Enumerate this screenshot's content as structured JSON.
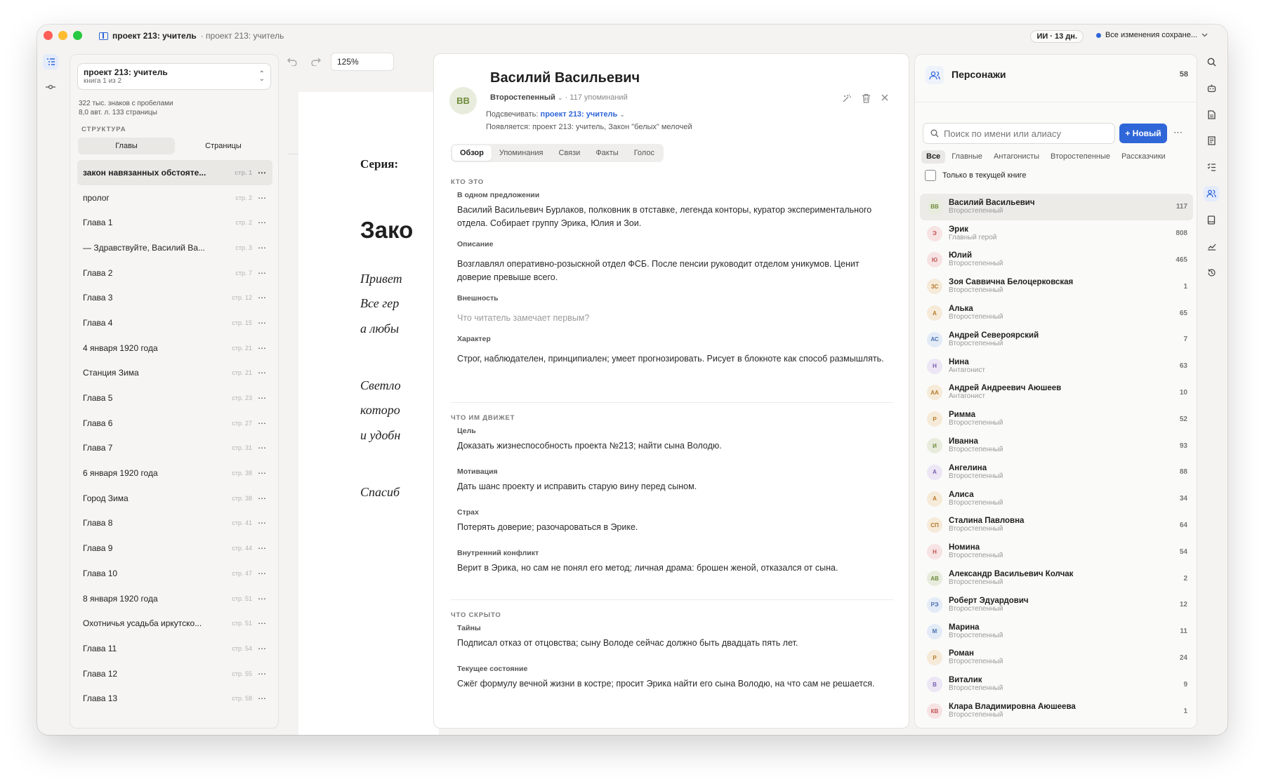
{
  "titlebar": {
    "title_bold": "проект 213: учитель",
    "title_sub": "· проект 213: учитель",
    "ai_pill": "ИИ · 13 дн.",
    "save_status": "Все изменения сохране..."
  },
  "project": {
    "name": "проект 213: учитель",
    "book_info": "книга 1 из 2",
    "stats_line1": "322 тыс. знаков с пробелами",
    "stats_line2": "8,0 авт. л.  133 страницы",
    "structure_label": "СТРУКТУРА",
    "seg_chapters": "Главы",
    "seg_pages": "Страницы"
  },
  "chapters": [
    {
      "name": "закон навязанных обстояте...",
      "page": "стр. 1",
      "active": true
    },
    {
      "name": "пролог",
      "page": "стр. 2"
    },
    {
      "name": "Глава 1",
      "page": "стр. 2"
    },
    {
      "name": "— Здравствуйте, Василий Ва...",
      "page": "стр. 3"
    },
    {
      "name": "Глава 2",
      "page": "стр. 7"
    },
    {
      "name": "Глава 3",
      "page": "стр. 12"
    },
    {
      "name": "Глава 4",
      "page": "стр. 15"
    },
    {
      "name": "4 января 1920 года",
      "page": "стр. 21"
    },
    {
      "name": "Станция Зима",
      "page": "стр. 21"
    },
    {
      "name": "Глава 5",
      "page": "стр. 23"
    },
    {
      "name": "Глава 6",
      "page": "стр. 27"
    },
    {
      "name": "Глава 7",
      "page": "стр. 31"
    },
    {
      "name": "6 января 1920 года",
      "page": "стр. 38"
    },
    {
      "name": "Город Зима",
      "page": "стр. 38"
    },
    {
      "name": "Глава 8",
      "page": "стр. 41"
    },
    {
      "name": "Глава 9",
      "page": "стр. 44"
    },
    {
      "name": "Глава 10",
      "page": "стр. 47"
    },
    {
      "name": "8 января 1920 года",
      "page": "стр. 51"
    },
    {
      "name": "Охотничья усадьба иркутско...",
      "page": "стр. 51"
    },
    {
      "name": "Глава 11",
      "page": "стр. 54"
    },
    {
      "name": "Глава 12",
      "page": "стр. 55"
    },
    {
      "name": "Глава 13",
      "page": "стр. 58"
    }
  ],
  "editor": {
    "zoom": "125%",
    "series": "Серия:",
    "heading": "Зако",
    "lines": [
      "Привет",
      "Все гер",
      "а любы",
      "Светло",
      "которо",
      "и удобн",
      "Спасиб"
    ]
  },
  "character": {
    "initials": "ВВ",
    "name": "Василий Васильевич",
    "role": "Второстепенный",
    "mentions": "· 117 упоминаний",
    "highlight_label": "Подсвечивать:",
    "highlight_value": "проект 213: учитель",
    "appears": "Появляется: проект 213: учитель, Закон \"белых\" мелочей",
    "tabs": [
      "Обзор",
      "Упоминания",
      "Связи",
      "Факты",
      "Голос"
    ],
    "sec_who": "КТО ЭТО",
    "sec_drive": "ЧТО ИМ ДВИЖЕТ",
    "sec_hidden": "ЧТО СКРЫТО",
    "one_sentence_label": "В одном предложении",
    "one_sentence": "Василий Васильевич Бурлаков, полковник в отставке, легенда конторы, куратор экспериментального отдела. Собирает группу Эрика, Юлия и Зои.",
    "description_label": "Описание",
    "description": "Возглавлял оперативно-розыскной отдел ФСБ. После пенсии руководит отделом уникумов. Ценит доверие превыше всего.",
    "appearance_label": "Внешность",
    "appearance_placeholder": "Что читатель замечает первым?",
    "character_label": "Характер",
    "character_text": "Строг, наблюдателен, принципиален; умеет прогнозировать. Рисует в блокноте как способ размышлять.",
    "goal_label": "Цель",
    "goal": "Доказать жизнеспособность проекта №213; найти сына Володю.",
    "motivation_label": "Мотивация",
    "motivation": "Дать шанс проекту и исправить старую вину перед сыном.",
    "fear_label": "Страх",
    "fear": "Потерять доверие; разочароваться в Эрике.",
    "conflict_label": "Внутренний конфликт",
    "conflict": "Верит в Эрика, но сам не понял его метод; личная драма: брошен женой, отказался от сына.",
    "secrets_label": "Тайны",
    "secrets": "Подписал отказ от отцовства; сыну Володе сейчас должно быть двадцать пять лет.",
    "state_label": "Текущее состояние",
    "state": "Сжёг формулу вечной жизни в костре; просит Эрика найти его сына Володю, на что сам не решается."
  },
  "characters_panel": {
    "title": "Персонажи",
    "count": "58",
    "search_placeholder": "Поиск по имени или алиасу",
    "new_button": "+ Новый",
    "filters": [
      "Все",
      "Главные",
      "Антагонисты",
      "Второстепенные",
      "Рассказчики"
    ],
    "only_current": "Только в текущей книге",
    "list": [
      {
        "initials": "ВВ",
        "name": "Василий Васильевич",
        "role": "Второстепенный",
        "count": "117",
        "bg": "#e8ecdd",
        "fg": "#6e8a3a",
        "active": true
      },
      {
        "initials": "Э",
        "name": "Эрик",
        "role": "Главный герой",
        "count": "808",
        "bg": "#f7e3e3",
        "fg": "#c25555"
      },
      {
        "initials": "Ю",
        "name": "Юлий",
        "role": "Второстепенный",
        "count": "465",
        "bg": "#f7e3e3",
        "fg": "#c25555"
      },
      {
        "initials": "ЗС",
        "name": "Зоя Саввична Белоцерковская",
        "role": "Второстепенный",
        "count": "1",
        "bg": "#f6ead8",
        "fg": "#b57a2c"
      },
      {
        "initials": "А",
        "name": "Алька",
        "role": "Второстепенный",
        "count": "65",
        "bg": "#f6ead8",
        "fg": "#b57a2c"
      },
      {
        "initials": "АС",
        "name": "Андрей Североярский",
        "role": "Второстепенный",
        "count": "7",
        "bg": "#e3ebf7",
        "fg": "#4a72b0"
      },
      {
        "initials": "Н",
        "name": "Нина",
        "role": "Антагонист",
        "count": "63",
        "bg": "#ece6f5",
        "fg": "#7a5fae"
      },
      {
        "initials": "АА",
        "name": "Андрей Андреевич Аюшеев",
        "role": "Антагонист",
        "count": "10",
        "bg": "#f6ead8",
        "fg": "#b57a2c"
      },
      {
        "initials": "Р",
        "name": "Римма",
        "role": "Второстепенный",
        "count": "52",
        "bg": "#f6ead8",
        "fg": "#b57a2c"
      },
      {
        "initials": "И",
        "name": "Иванна",
        "role": "Второстепенный",
        "count": "93",
        "bg": "#e8ecdd",
        "fg": "#6e8a3a"
      },
      {
        "initials": "А",
        "name": "Ангелина",
        "role": "Второстепенный",
        "count": "88",
        "bg": "#ece6f5",
        "fg": "#7a5fae"
      },
      {
        "initials": "А",
        "name": "Алиса",
        "role": "Второстепенный",
        "count": "34",
        "bg": "#f6ead8",
        "fg": "#b57a2c"
      },
      {
        "initials": "СП",
        "name": "Сталина Павловна",
        "role": "Второстепенный",
        "count": "64",
        "bg": "#f6ead8",
        "fg": "#b57a2c"
      },
      {
        "initials": "Н",
        "name": "Номина",
        "role": "Второстепенный",
        "count": "54",
        "bg": "#f7e3e3",
        "fg": "#c25555"
      },
      {
        "initials": "АВ",
        "name": "Александр Васильевич Колчак",
        "role": "Второстепенный",
        "count": "2",
        "bg": "#e8ecdd",
        "fg": "#6e8a3a"
      },
      {
        "initials": "РЭ",
        "name": "Роберт Эдуардович",
        "role": "Второстепенный",
        "count": "12",
        "bg": "#e3ebf7",
        "fg": "#4a72b0"
      },
      {
        "initials": "М",
        "name": "Марина",
        "role": "Второстепенный",
        "count": "11",
        "bg": "#e3ebf7",
        "fg": "#4a72b0"
      },
      {
        "initials": "Р",
        "name": "Роман",
        "role": "Второстепенный",
        "count": "24",
        "bg": "#f6ead8",
        "fg": "#b57a2c"
      },
      {
        "initials": "В",
        "name": "Виталик",
        "role": "Второстепенный",
        "count": "9",
        "bg": "#ece6f5",
        "fg": "#7a5fae"
      },
      {
        "initials": "КВ",
        "name": "Клара Владимировна Аюшеева",
        "role": "Второстепенный",
        "count": "1",
        "bg": "#f7e3e3",
        "fg": "#c25555"
      }
    ]
  },
  "colors": {
    "accent": "#2f66d8",
    "window_bg": "#f4f3f1"
  }
}
